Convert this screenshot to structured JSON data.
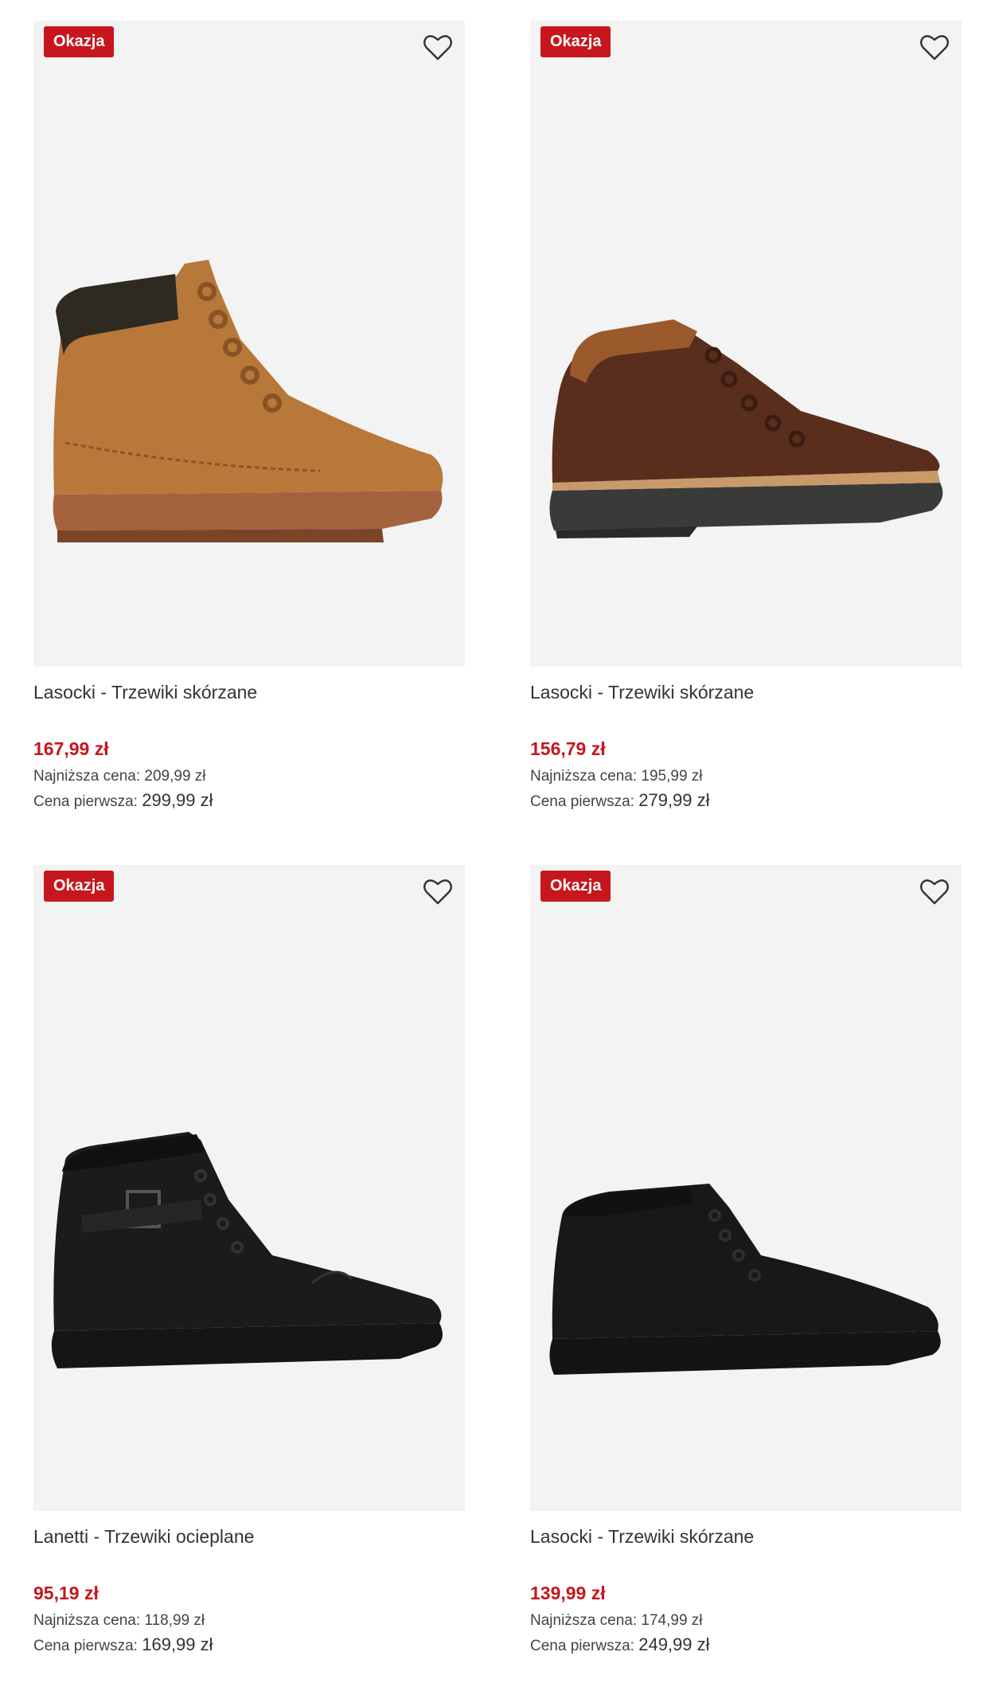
{
  "products": [
    {
      "badge": "Okazja",
      "title": "Lasocki - Trzewiki skórzane",
      "price": "167,99 zł",
      "lowest_label": "Najniższa cena:",
      "lowest_value": "209,99 zł",
      "first_label": "Cena pierwsza:",
      "first_value": "299,99 zł",
      "boot_colors": {
        "upper": "#b7783a",
        "collar": "#2e2a22",
        "sole": "#a5623e",
        "accent": "#8a5326"
      }
    },
    {
      "badge": "Okazja",
      "title": "Lasocki - Trzewiki skórzane",
      "price": "156,79 zł",
      "lowest_label": "Najniższa cena:",
      "lowest_value": "195,99 zł",
      "first_label": "Cena pierwsza:",
      "first_value": "279,99 zł",
      "boot_colors": {
        "upper": "#5a2e1c",
        "collar": "#9a5a2c",
        "sole": "#3a3a38",
        "accent": "#3a1d12"
      }
    },
    {
      "badge": "Okazja",
      "title": "Lanetti - Trzewiki ocieplane",
      "price": "95,19 zł",
      "lowest_label": "Najniższa cena:",
      "lowest_value": "118,99 zł",
      "first_label": "Cena pierwsza:",
      "first_value": "169,99 zł",
      "boot_colors": {
        "upper": "#1b1b1b",
        "collar": "#101010",
        "sole": "#151515",
        "accent": "#333333"
      }
    },
    {
      "badge": "Okazja",
      "title": "Lasocki - Trzewiki skórzane",
      "price": "139,99 zł",
      "lowest_label": "Najniższa cena:",
      "lowest_value": "174,99 zł",
      "first_label": "Cena pierwsza:",
      "first_value": "249,99 zł",
      "boot_colors": {
        "upper": "#181818",
        "collar": "#111111",
        "sole": "#141414",
        "accent": "#2e2e2e"
      }
    }
  ],
  "colors": {
    "sale_red": "#c8161d",
    "image_bg": "#f3f3f3"
  },
  "icons": {
    "wishlist": "heart-outline-icon"
  }
}
